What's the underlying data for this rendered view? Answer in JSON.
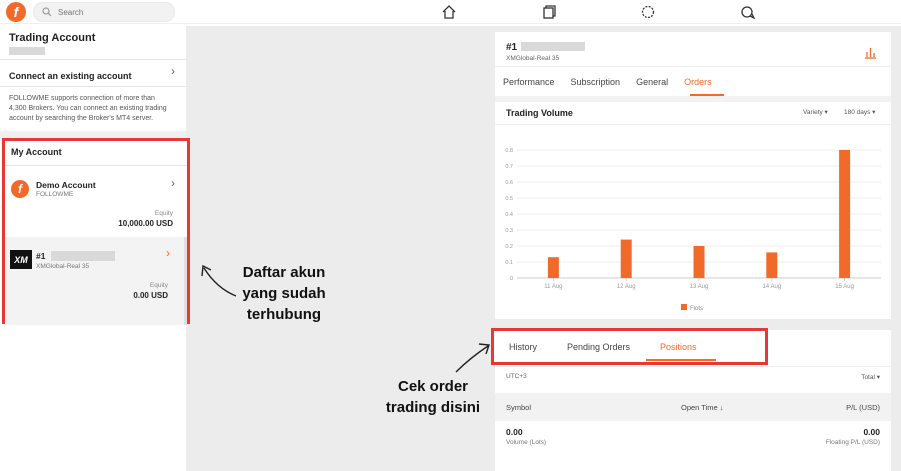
{
  "topbar": {
    "logo_letter": "f",
    "search_placeholder": "Search",
    "nav_icons": [
      "home-icon",
      "copy-icon",
      "compass-icon",
      "chat-icon"
    ]
  },
  "left": {
    "trading_title": "Trading Account",
    "connect_label": "Connect an existing account",
    "connect_desc": "FOLLOWME supports connection of more than 4,300 Brokers. You can connect an existing trading account by searching the Broker's MT4 server.",
    "my_account_title": "My Account",
    "accounts": [
      {
        "name": "Demo Account",
        "sub": "FOLLOWME",
        "equity_label": "Equity",
        "equity_value": "10,000.00 USD",
        "logo_text": "f"
      },
      {
        "name": "#1",
        "sub": "XMGlobal-Real 35",
        "equity_label": "Equity",
        "equity_value": "0.00 USD",
        "logo_text": "XM"
      }
    ]
  },
  "account_header": {
    "name": "#1",
    "server": "XMGlobal-Real 35"
  },
  "tabs": [
    "Performance",
    "Subscription",
    "General",
    "Orders"
  ],
  "active_tab": "Orders",
  "volume": {
    "title": "Trading Volume",
    "filter1": "Variety ▾",
    "filter2": "180 days ▾"
  },
  "chart_data": {
    "type": "bar",
    "categories": [
      "11 Aug",
      "12 Aug",
      "13 Aug",
      "14 Aug",
      "15 Aug"
    ],
    "series": [
      {
        "name": "Flots",
        "values": [
          0.13,
          0.24,
          0.2,
          0.16,
          0.8
        ]
      }
    ],
    "yticks": [
      "0",
      "0.1",
      "0.2",
      "0.3",
      "0.4",
      "0.5",
      "0.6",
      "0.7",
      "0.8"
    ],
    "ylim": [
      0,
      0.85
    ],
    "legend": "Flots",
    "color": "#f26a2a"
  },
  "orders_tabs": [
    "History",
    "Pending Orders",
    "Positions"
  ],
  "orders_active": "Positions",
  "positions": {
    "timezone": "UTC+3",
    "total_label": "Total ▾",
    "columns": [
      "Symbol",
      "Open Time ↓",
      "P/L (USD)"
    ],
    "volume_value": "0.00",
    "volume_label": "Volume (Lots)",
    "pl_value": "0.00",
    "pl_label": "Floating P/L (USD)"
  },
  "annotations": {
    "left": [
      "Daftar akun",
      "yang sudah",
      "terhubung"
    ],
    "bottom": [
      "Cek order",
      "trading disini"
    ]
  },
  "colors": {
    "accent": "#f26a2a",
    "highlight": "#e53935"
  }
}
